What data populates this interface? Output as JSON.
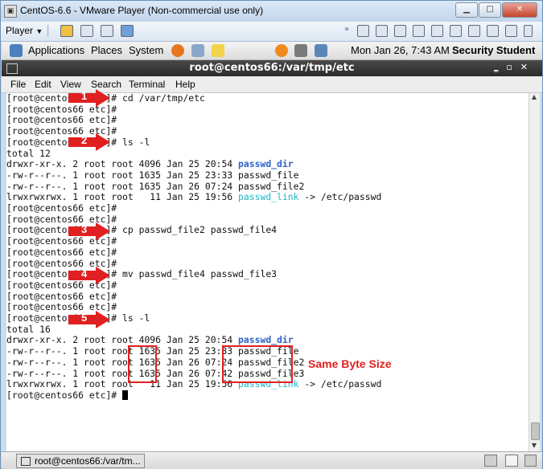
{
  "window": {
    "title": "CentOS-6.6 - VMware Player (Non-commercial use only)"
  },
  "vm_toolbar": {
    "player_label": "Player"
  },
  "gnome_panel": {
    "applications": "Applications",
    "places": "Places",
    "system": "System",
    "datetime": "Mon Jan 26,  7:43 AM",
    "user": "Security Student"
  },
  "terminal": {
    "title": "root@centos66:/var/tmp/etc",
    "menu": [
      "File",
      "Edit",
      "View",
      "Search",
      "Terminal",
      "Help"
    ],
    "lines": [
      "[root@centos66 etc]# cd /var/tmp/etc",
      "[root@centos66 etc]#",
      "[root@centos66 etc]#",
      "[root@centos66 etc]#",
      "[root@centos66 etc]# ls -l",
      "total 12",
      "drwxr-xr-x. 2 root root 4096 Jan 25 20:54 passwd_dir",
      "-rw-r--r--. 1 root root 1635 Jan 25 23:33 passwd_file",
      "-rw-r--r--. 1 root root 1635 Jan 26 07:24 passwd_file2",
      "lrwxrwxrwx. 1 root root   11 Jan 25 19:56 passwd_link -> /etc/passwd",
      "[root@centos66 etc]#",
      "[root@centos66 etc]#",
      "[root@centos66 etc]# cp passwd_file2 passwd_file4",
      "[root@centos66 etc]#",
      "[root@centos66 etc]#",
      "[root@centos66 etc]#",
      "[root@centos66 etc]# mv passwd_file4 passwd_file3",
      "[root@centos66 etc]#",
      "[root@centos66 etc]#",
      "[root@centos66 etc]#",
      "[root@centos66 etc]# ls -l",
      "total 16",
      "drwxr-xr-x. 2 root root 4096 Jan 25 20:54 passwd_dir",
      "-rw-r--r--. 1 root root 1635 Jan 25 23:33 passwd_file",
      "-rw-r--r--. 1 root root 1635 Jan 26 07:24 passwd_file2",
      "-rw-r--r--. 1 root root 1635 Jan 26 07:42 passwd_file3",
      "lrwxrwxrwx. 1 root root   11 Jan 25 19:56 passwd_link -> /etc/passwd",
      "[root@centos66 etc]# "
    ],
    "dir_color": "#2e62c9",
    "link_color": "#1fb7c9"
  },
  "annotations": {
    "steps": [
      "1",
      "2",
      "3",
      "4",
      "5"
    ],
    "note": "Same Byte Size",
    "color": "#e02020"
  },
  "taskbar": {
    "task_label": "root@centos66:/var/tm..."
  }
}
